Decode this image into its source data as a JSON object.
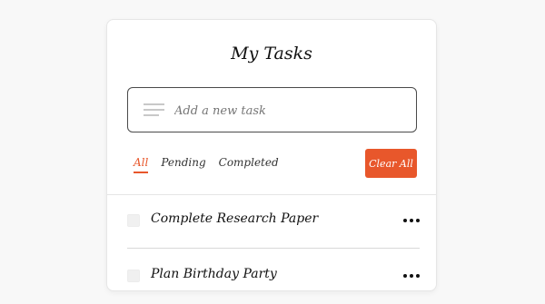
{
  "app": {
    "title": "My Tasks"
  },
  "input": {
    "placeholder": "Add a new task",
    "value": ""
  },
  "filters": {
    "tabs": [
      {
        "label": "All",
        "active": true
      },
      {
        "label": "Pending",
        "active": false
      },
      {
        "label": "Completed",
        "active": false
      }
    ],
    "clear_label": "Clear All"
  },
  "tasks": [
    {
      "label": "Complete Research Paper",
      "done": false
    },
    {
      "label": "Plan Birthday Party",
      "done": false
    }
  ],
  "colors": {
    "accent": "#e8572b",
    "card_background": "#ffffff",
    "page_background": "#f8f8f8"
  }
}
